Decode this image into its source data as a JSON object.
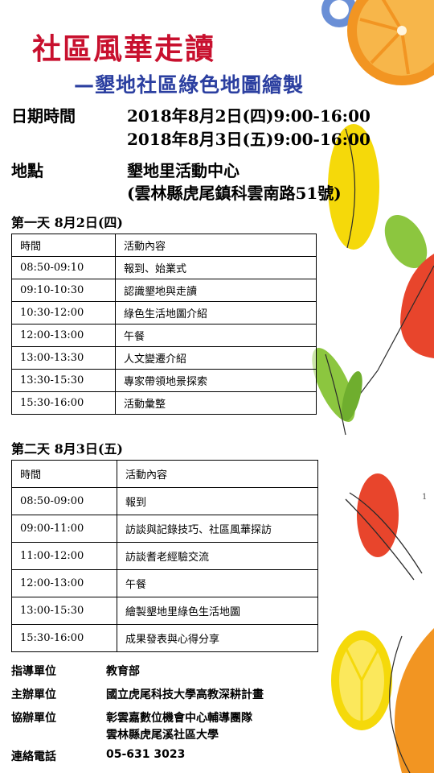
{
  "title": "社區風華走讀",
  "subtitle": "—墾地社區綠色地圖繪製",
  "datetime": {
    "label": "日期時間",
    "lines": [
      "2018年8月2日(四)9:00-16:00",
      "2018年8月3日(五)9:00-16:00"
    ]
  },
  "location": {
    "label": "地點",
    "name": "墾地里活動中心",
    "address": "(雲林縣虎尾鎮科雲南路51號)"
  },
  "day1": {
    "heading": "第一天 8月2日(四)",
    "header": [
      "時間",
      "活動內容"
    ],
    "rows": [
      [
        "08:50-09:10",
        "報到、始業式"
      ],
      [
        "09:10-10:30",
        "認識墾地與走讀"
      ],
      [
        "10:30-12:00",
        "綠色生活地圖介紹"
      ],
      [
        "12:00-13:00",
        "午餐"
      ],
      [
        "13:00-13:30",
        "人文變遷介紹"
      ],
      [
        "13:30-15:30",
        "專家帶領地景探索"
      ],
      [
        "15:30-16:00",
        "活動彙整"
      ]
    ]
  },
  "day2": {
    "heading": "第二天 8月3日(五)",
    "header": [
      "時間",
      "活動內容"
    ],
    "rows": [
      [
        "08:50-09:00",
        "報到"
      ],
      [
        "09:00-11:00",
        "訪談與記錄技巧、社區風華探訪"
      ],
      [
        "11:00-12:00",
        "訪談耆老經驗交流"
      ],
      [
        "12:00-13:00",
        "午餐"
      ],
      [
        "13:00-15:30",
        "繪製墾地里綠色生活地圖"
      ],
      [
        "15:30-16:00",
        "成果發表與心得分享"
      ]
    ]
  },
  "organizers": [
    {
      "label": "指導單位",
      "value": "教育部"
    },
    {
      "label": "主辦單位",
      "value": "國立虎尾科技大學高教深耕計畫"
    },
    {
      "label": "協辦單位",
      "value": "彰雲嘉數位機會中心輔導團隊"
    },
    {
      "label": "",
      "value": "雲林縣虎尾溪社區大學"
    },
    {
      "label": "連絡電話",
      "value": "05-631 3023"
    }
  ],
  "page_number": "1",
  "colors": {
    "title": "#c8102e",
    "subtitle": "#2b3fa0",
    "orange": "#f29522",
    "yellow": "#f5d90a",
    "red": "#e8452c",
    "green": "#8cc63f",
    "blue": "#6a8fd6"
  }
}
